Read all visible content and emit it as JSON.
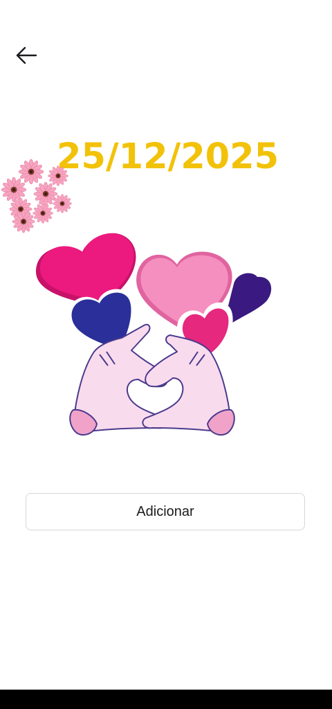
{
  "header": {
    "back_icon": "arrow-left-icon"
  },
  "main": {
    "date": "25/12/2025",
    "decoration_icon": "flowers",
    "sticker_icon": "hands-heart-sticker",
    "date_color": "#f2c20a"
  },
  "actions": {
    "add_label": "Adicionar"
  }
}
